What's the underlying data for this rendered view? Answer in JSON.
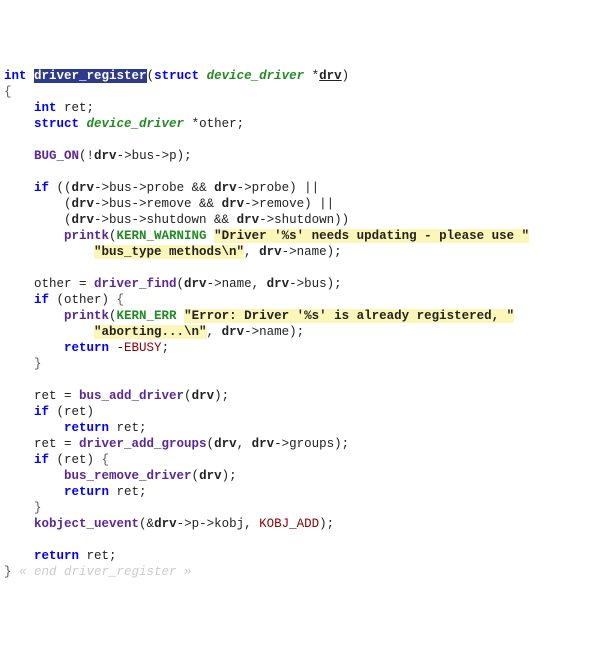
{
  "code": {
    "ret_type": "int",
    "fn_name": "driver_register",
    "param_struct": "struct",
    "param_type": "device_driver",
    "param_name": "drv",
    "int_kw": "int",
    "ret_var": "ret",
    "struct_kw": "struct",
    "other_type": "device_driver",
    "other_var": "other",
    "bug_on": "BUG_ON",
    "drv": "drv",
    "bus": "bus",
    "p": "p",
    "if_kw": "if",
    "probe": "probe",
    "remove": "remove",
    "shutdown": "shutdown",
    "printk": "printk",
    "kern_warning": "KERN_WARNING",
    "str_driver_update": "\"Driver '%s' needs updating - please use \"",
    "str_bus_type": "\"bus_type methods\\n\"",
    "name": "name",
    "driver_find": "driver_find",
    "kern_err": "KERN_ERR",
    "str_err1": "\"Error: Driver '%s' is already registered, \"",
    "str_err2": "\"aborting...\\n\"",
    "return_kw": "return",
    "ebusy": "EBUSY",
    "bus_add_driver": "bus_add_driver",
    "driver_add_groups": "driver_add_groups",
    "groups": "groups",
    "bus_remove_driver": "bus_remove_driver",
    "kobject_uevent": "kobject_uevent",
    "kobj": "kobj",
    "kobj_add": "KOBJ_ADD",
    "end_comment": "« end driver_register »"
  }
}
